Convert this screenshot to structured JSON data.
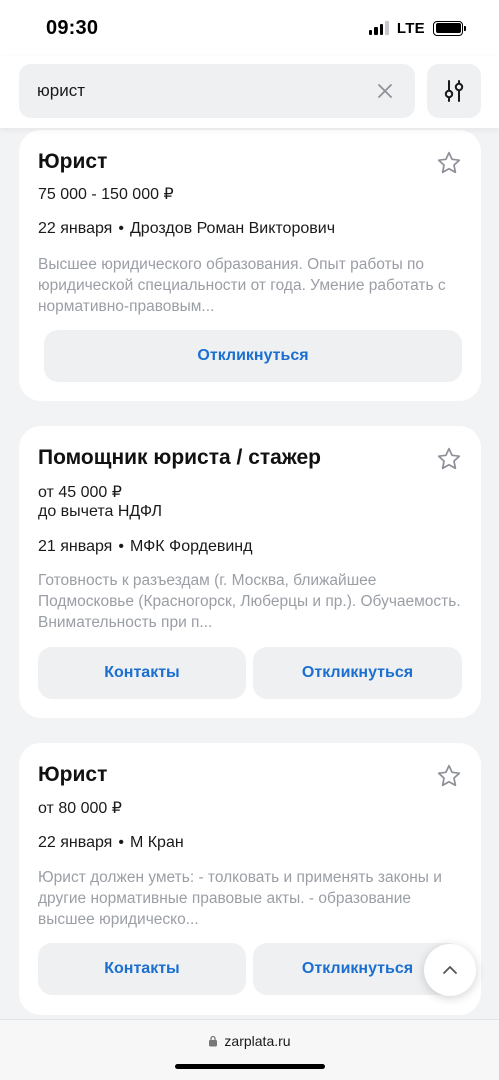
{
  "status_bar": {
    "time": "09:30",
    "network": "LTE"
  },
  "search": {
    "query": "юрист"
  },
  "vacancies": [
    {
      "title": "Юрист",
      "salary": "75 000 - 150 000 ₽",
      "date": "22 января",
      "employer": "Дроздов Роман Викторович",
      "description": "Высшее юридического образования. Опыт работы по юридической специальности от года. Умение работать с нормативно-правовым...",
      "respond_label": "Откликнуться"
    },
    {
      "title": "Помощник юриста / стажер",
      "salary": "от 45 000 ₽",
      "salary_note": "до вычета НДФЛ",
      "date": "21 января",
      "employer": "МФК Фордевинд",
      "description": "Готовность к разъездам (г. Москва, ближайшее Подмосковье (Красногорск, Люберцы и пр.). Обучаемость. Внимательность при п...",
      "contacts_label": "Контакты",
      "respond_label": "Откликнуться"
    },
    {
      "title": "Юрист",
      "salary": "от 80 000 ₽",
      "date": "22 января",
      "employer": "М Кран",
      "description": "Юрист должен уметь: - толковать и применять законы и другие нормативные правовые акты. - образование высшее юридическо...",
      "contacts_label": "Контакты",
      "respond_label": "Откликнуться"
    }
  ],
  "meta_separator": "•",
  "browser": {
    "url": "zarplata.ru"
  },
  "icons": {
    "clear": "close-icon",
    "filter": "filter-sliders-icon",
    "favorite": "star-outline-icon",
    "scroll_top": "chevron-up-icon",
    "lock": "lock-icon"
  },
  "colors": {
    "accent": "#1a6fd0",
    "muted_text": "#9a9ea5",
    "button_bg": "#eef0f2"
  }
}
